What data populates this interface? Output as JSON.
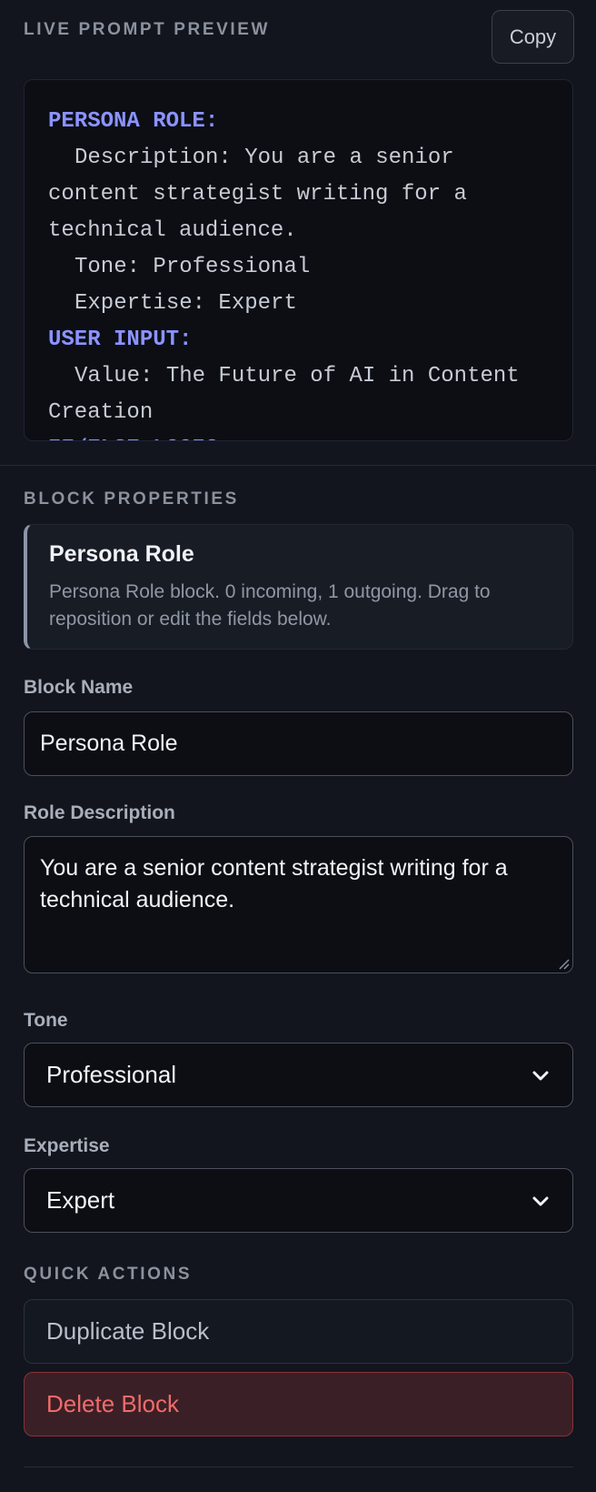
{
  "preview": {
    "title": "LIVE PROMPT PREVIEW",
    "copy_label": "Copy",
    "code": {
      "persona_key": "PERSONA ROLE:",
      "description_line": "Description: You are a senior content strategist writing for a technical audience.",
      "tone_line": "Tone: Professional",
      "expertise_line": "Expertise: Expert",
      "user_key": "USER INPUT:",
      "value_line": "Value: The Future of AI in Content Creation",
      "ifelse_key": "IF/ELSE LOGIC:"
    }
  },
  "properties": {
    "title": "BLOCK PROPERTIES",
    "card": {
      "title": "Persona Role",
      "description": "Persona Role block. 0 incoming, 1 outgoing. Drag to reposition or edit the fields below."
    },
    "block_name": {
      "label": "Block Name",
      "value": "Persona Role"
    },
    "role_description": {
      "label": "Role Description",
      "value": "You are a senior content strategist writing for a technical audience."
    },
    "tone": {
      "label": "Tone",
      "value": "Professional"
    },
    "expertise": {
      "label": "Expertise",
      "value": "Expert"
    }
  },
  "quick_actions": {
    "title": "QUICK ACTIONS",
    "duplicate_label": "Duplicate Block",
    "delete_label": "Delete Block"
  },
  "colors": {
    "accent_key": "#8b93ff",
    "danger": "#f06b6b"
  }
}
